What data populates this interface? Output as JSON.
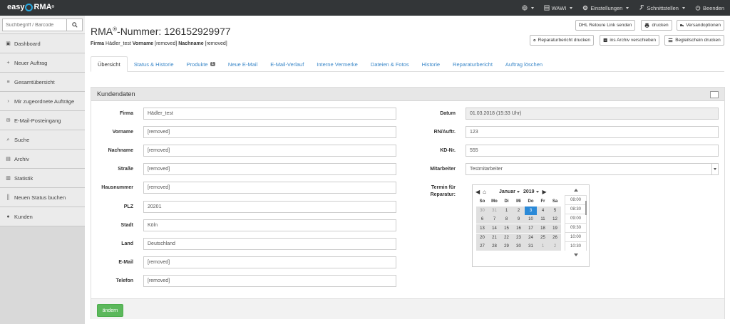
{
  "brand": {
    "left": "easy",
    "right": "RMA",
    "reg": "®"
  },
  "topnav": [
    {
      "label": "",
      "icon": "globe-icon"
    },
    {
      "label": "WAWI",
      "icon": "table-icon"
    },
    {
      "label": "Einstellungen",
      "icon": "gear-icon"
    },
    {
      "label": "Schnittstellen",
      "icon": "wrench-icon"
    },
    {
      "label": "Beenden",
      "icon": "power-icon"
    }
  ],
  "sidebar": {
    "search_placeholder": "Suchbegriff / Barcode",
    "items": [
      {
        "label": "Dashboard",
        "icon": "dashboard-icon"
      },
      {
        "label": "Neuer Auftrag",
        "icon": "plus-icon"
      },
      {
        "label": "Gesamtübersicht",
        "icon": "list-icon"
      },
      {
        "label": "Mir zugeordnete Aufträge",
        "icon": "chevron-right-icon"
      },
      {
        "label": "E-Mail-Posteingang",
        "icon": "envelope-icon"
      },
      {
        "label": "Suche",
        "icon": "search-icon"
      },
      {
        "label": "Archiv",
        "icon": "archive-icon"
      },
      {
        "label": "Statistik",
        "icon": "chart-icon"
      },
      {
        "label": "Neuen Status buchen",
        "icon": "barcode-icon"
      },
      {
        "label": "Kunden",
        "icon": "users-icon"
      }
    ]
  },
  "header": {
    "title_prefix": "RMA",
    "title_reg": "®",
    "title_suffix": "-Nummer: 126152929977",
    "sub": {
      "firma_label": "Firma",
      "firma_value": "Hädler_test",
      "vorname_label": "Vorname",
      "vorname_value": "[removed]",
      "nachname_label": "Nachname",
      "nachname_value": "[removed]"
    }
  },
  "buttons": {
    "dhl": "DHL Retoure Link senden",
    "print": "drucken",
    "shipping": "Versandoptionen",
    "repair_report": "Reparaturbericht drucken",
    "archive": "ins Archiv verschieben",
    "delivery_note": "Begleitschein drucken"
  },
  "tabs": [
    {
      "label": "Übersicht",
      "active": true
    },
    {
      "label": "Status & Historie"
    },
    {
      "label": "Produkte",
      "badge": "1"
    },
    {
      "label": "Neue E-Mail"
    },
    {
      "label": "E-Mail-Verlauf"
    },
    {
      "label": "Interne Vermerke"
    },
    {
      "label": "Dateien & Fotos"
    },
    {
      "label": "Historie"
    },
    {
      "label": "Reparaturbericht"
    },
    {
      "label": "Auftrag löschen"
    }
  ],
  "panel": {
    "title": "Kundendaten"
  },
  "left_fields": [
    {
      "label": "Firma",
      "value": "Hädler_test"
    },
    {
      "label": "Vorname",
      "value": "[removed]"
    },
    {
      "label": "Nachname",
      "value": "[removed]"
    },
    {
      "label": "Straße",
      "value": "[removed]"
    },
    {
      "label": "Hausnummer",
      "value": "[removed]"
    },
    {
      "label": "PLZ",
      "value": "20201"
    },
    {
      "label": "Stadt",
      "value": "Köln"
    },
    {
      "label": "Land",
      "value": "Deutschland"
    },
    {
      "label": "E-Mail",
      "value": "[removed]"
    },
    {
      "label": "Telefon",
      "value": "[removed]"
    }
  ],
  "right_fields": {
    "datum": {
      "label": "Datum",
      "value": "01.03.2018 (15:33 Uhr)"
    },
    "rn": {
      "label": "RN/Auftr.",
      "value": "123"
    },
    "kd": {
      "label": "KD-Nr.",
      "value": "555"
    },
    "mitarbeiter": {
      "label": "Mitarbeiter",
      "value": "Testmitarbeiter"
    },
    "termin": {
      "label": "Termin für Reparatur:"
    }
  },
  "calendar": {
    "month": "Januar",
    "year": "2019",
    "weekdays": [
      "So",
      "Mo",
      "Di",
      "Mi",
      "Do",
      "Fr",
      "Sa"
    ],
    "weeks": [
      [
        "30",
        "31",
        "1",
        "2",
        "3",
        "4",
        "5"
      ],
      [
        "6",
        "7",
        "8",
        "9",
        "10",
        "11",
        "12"
      ],
      [
        "13",
        "14",
        "15",
        "16",
        "17",
        "18",
        "19"
      ],
      [
        "20",
        "21",
        "22",
        "23",
        "24",
        "25",
        "26"
      ],
      [
        "27",
        "28",
        "29",
        "30",
        "31",
        "1",
        "2"
      ]
    ],
    "selected": "3",
    "times": [
      "08:00",
      "08:30",
      "09:00",
      "09:30",
      "10:00",
      "10:30"
    ]
  },
  "footer": {
    "save_label": "ändern"
  }
}
